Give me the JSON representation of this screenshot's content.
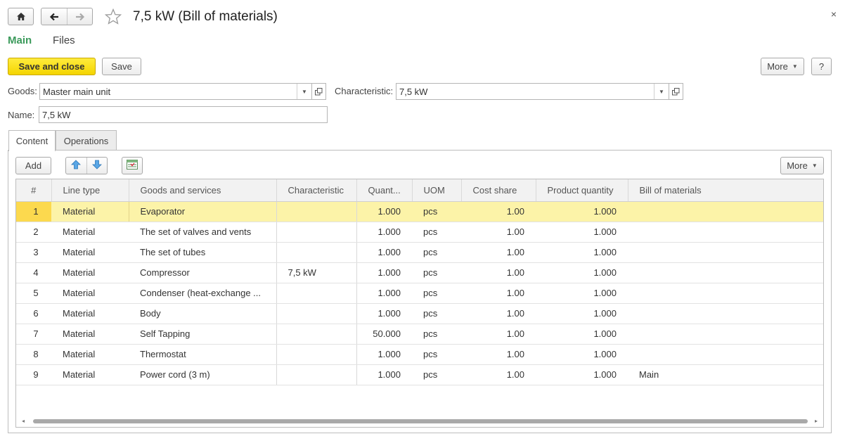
{
  "window": {
    "title": "7,5 kW (Bill of materials)",
    "close_label": "×"
  },
  "main_tabs": [
    {
      "label": "Main",
      "active": true
    },
    {
      "label": "Files",
      "active": false
    }
  ],
  "toolbar": {
    "save_close_label": "Save and close",
    "save_label": "Save",
    "more_label": "More",
    "help_label": "?"
  },
  "form": {
    "goods_label": "Goods:",
    "goods_value": "Master main unit",
    "characteristic_label": "Characteristic:",
    "characteristic_value": "7,5 kW",
    "name_label": "Name:",
    "name_value": "7,5 kW"
  },
  "sub_tabs": [
    {
      "label": "Content",
      "active": true
    },
    {
      "label": "Operations",
      "active": false
    }
  ],
  "table_toolbar": {
    "add_label": "Add",
    "more_label": "More"
  },
  "table": {
    "columns": [
      "#",
      "Line type",
      "Goods and services",
      "Characteristic",
      "Quant...",
      "UOM",
      "Cost share",
      "Product quantity",
      "Bill of materials"
    ],
    "selected_row": 0,
    "rows": [
      {
        "num": "1",
        "line_type": "Material",
        "goods": "Evaporator",
        "characteristic": "",
        "quantity": "1.000",
        "uom": "pcs",
        "cost_share": "1.00",
        "product_quantity": "1.000",
        "bom": ""
      },
      {
        "num": "2",
        "line_type": "Material",
        "goods": "The set of valves and vents",
        "characteristic": "",
        "quantity": "1.000",
        "uom": "pcs",
        "cost_share": "1.00",
        "product_quantity": "1.000",
        "bom": ""
      },
      {
        "num": "3",
        "line_type": "Material",
        "goods": "The set of tubes",
        "characteristic": "",
        "quantity": "1.000",
        "uom": "pcs",
        "cost_share": "1.00",
        "product_quantity": "1.000",
        "bom": ""
      },
      {
        "num": "4",
        "line_type": "Material",
        "goods": "Compressor",
        "characteristic": "7,5 kW",
        "quantity": "1.000",
        "uom": "pcs",
        "cost_share": "1.00",
        "product_quantity": "1.000",
        "bom": ""
      },
      {
        "num": "5",
        "line_type": "Material",
        "goods": "Condenser (heat-exchange ...",
        "characteristic": "",
        "quantity": "1.000",
        "uom": "pcs",
        "cost_share": "1.00",
        "product_quantity": "1.000",
        "bom": ""
      },
      {
        "num": "6",
        "line_type": "Material",
        "goods": "Body",
        "characteristic": "",
        "quantity": "1.000",
        "uom": "pcs",
        "cost_share": "1.00",
        "product_quantity": "1.000",
        "bom": ""
      },
      {
        "num": "7",
        "line_type": "Material",
        "goods": "Self Tapping",
        "characteristic": "",
        "quantity": "50.000",
        "uom": "pcs",
        "cost_share": "1.00",
        "product_quantity": "1.000",
        "bom": ""
      },
      {
        "num": "8",
        "line_type": "Material",
        "goods": "Thermostat",
        "characteristic": "",
        "quantity": "1.000",
        "uom": "pcs",
        "cost_share": "1.00",
        "product_quantity": "1.000",
        "bom": ""
      },
      {
        "num": "9",
        "line_type": "Material",
        "goods": "Power cord (3 m)",
        "characteristic": "",
        "quantity": "1.000",
        "uom": "pcs",
        "cost_share": "1.00",
        "product_quantity": "1.000",
        "bom": "Main"
      }
    ]
  },
  "colors": {
    "accent_green": "#3b9a5b",
    "primary_button": "#f4d400",
    "selected_row": "#fcf3a8",
    "current_cell": "#fcd94e"
  },
  "icons": [
    "home-icon",
    "back-arrow-icon",
    "forward-arrow-icon",
    "favorite-star-icon",
    "close-icon",
    "dropdown-icon",
    "open-icon",
    "move-up-icon",
    "move-down-icon",
    "table-settings-icon"
  ]
}
